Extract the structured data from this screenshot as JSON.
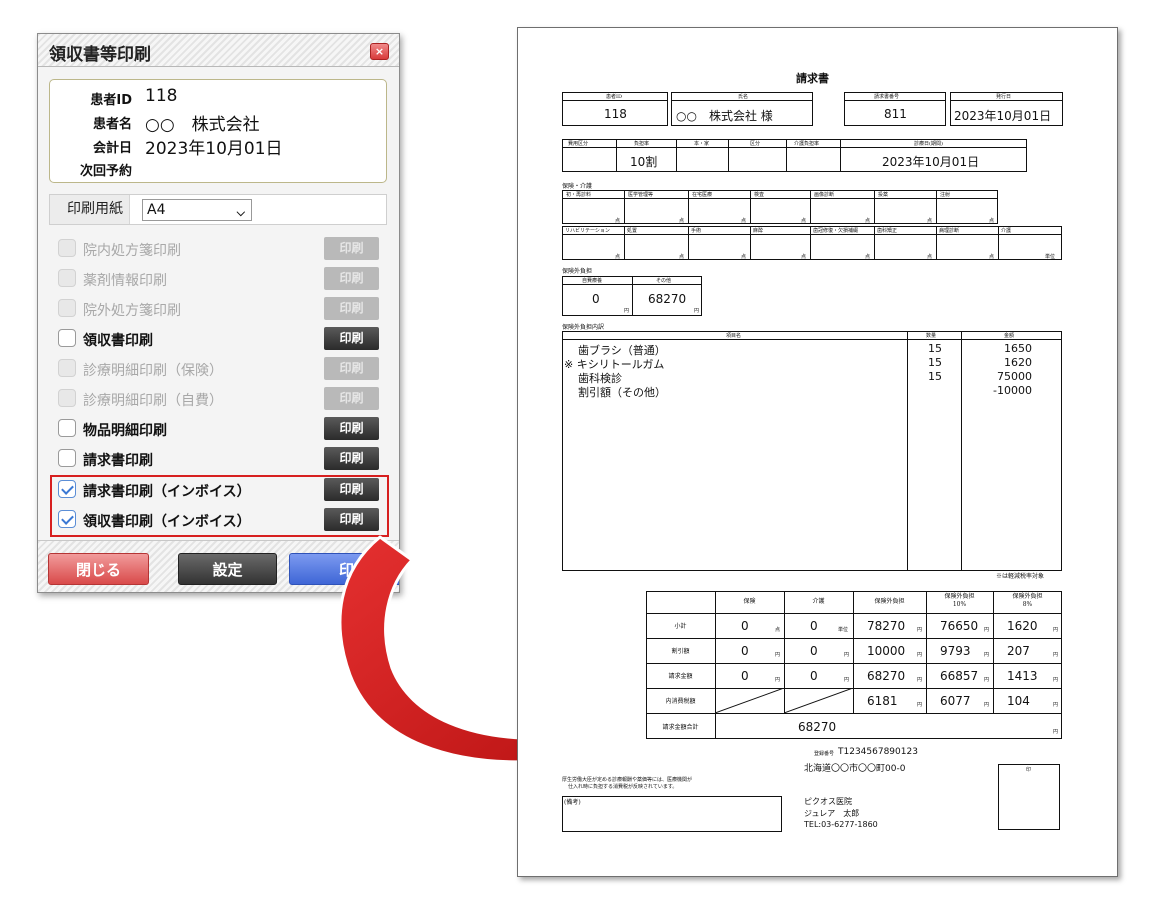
{
  "dialog": {
    "title": "領収書等印刷",
    "close_icon": "×",
    "patient": {
      "id_label": "患者ID",
      "id_value": "118",
      "name_label": "患者名",
      "name_value": "○○　株式会社",
      "date_label": "会計日",
      "date_value": "2023年10月01日",
      "next_label": "次回予約",
      "next_value": ""
    },
    "paper": {
      "label": "印刷用紙",
      "value": "A4"
    },
    "options": [
      {
        "label": "院内処方箋印刷",
        "enabled": false,
        "checked": false,
        "button": "印刷"
      },
      {
        "label": "薬剤情報印刷",
        "enabled": false,
        "checked": false,
        "button": "印刷"
      },
      {
        "label": "院外処方箋印刷",
        "enabled": false,
        "checked": false,
        "button": "印刷"
      },
      {
        "label": "領収書印刷",
        "enabled": true,
        "checked": false,
        "button": "印刷"
      },
      {
        "label": "診療明細印刷（保険）",
        "enabled": false,
        "checked": false,
        "button": "印刷"
      },
      {
        "label": "診療明細印刷（自費）",
        "enabled": false,
        "checked": false,
        "button": "印刷"
      },
      {
        "label": "物品明細印刷",
        "enabled": true,
        "checked": false,
        "button": "印刷"
      },
      {
        "label": "請求書印刷",
        "enabled": true,
        "checked": false,
        "button": "印刷"
      },
      {
        "label": "請求書印刷（インボイス）",
        "enabled": true,
        "checked": true,
        "button": "印刷"
      },
      {
        "label": "領収書印刷（インボイス）",
        "enabled": true,
        "checked": true,
        "button": "印刷"
      }
    ],
    "footer": {
      "close": "閉じる",
      "settings": "設定",
      "print": "印刷"
    }
  },
  "invoice": {
    "title": "請求書",
    "header": {
      "patient_id_label": "患者ID",
      "patient_id": "118",
      "name_label": "氏名",
      "name": "○○　株式会社 様",
      "invoice_no_label": "請求書番号",
      "invoice_no": "811",
      "issue_date_label": "発行日",
      "issue_date": "2023年10月01日"
    },
    "row2": {
      "labels": [
        "費用区分",
        "負担率",
        "本・家",
        "区分",
        "介護負担率",
        "診療日(期間)"
      ],
      "rate": "10割",
      "period": "2023年10月01日"
    },
    "insurance_label": "保険・介護",
    "ins_row1": [
      "初・再診料",
      "医学管理等",
      "在宅医療",
      "検査",
      "画像診断",
      "投薬",
      "注射"
    ],
    "ins_row2": [
      "リハビリテーション",
      "処置",
      "手術",
      "麻酔",
      "歯冠修復・欠損補綴",
      "歯科矯正",
      "病理診断",
      "介護"
    ],
    "unit_point": "点",
    "unit_tan": "単位",
    "unit_yen": "円",
    "self_pay_label": "保険外負担",
    "self_pay_cols": [
      "自費療養",
      "その他"
    ],
    "self_pay_values": [
      "0",
      "68270"
    ],
    "detail_label": "保険外負担内訳",
    "detail_cols": [
      "項目名",
      "数量",
      "金額"
    ],
    "items": [
      {
        "name": "歯ブラシ（普通）",
        "qty": "15",
        "amount": "1650"
      },
      {
        "name": "※ キシリトールガム",
        "qty": "15",
        "amount": "1620"
      },
      {
        "name": "歯科検診",
        "qty": "15",
        "amount": "75000"
      },
      {
        "name": "割引額（その他）",
        "qty": "",
        "amount": "-10000"
      }
    ],
    "reduced_note": "※は軽減税率対象",
    "summary_cols": [
      "保険",
      "介護",
      "保険外負担",
      "保険外負担\n10%",
      "保険外負担\n8%"
    ],
    "summary_rows": [
      {
        "label": "小計",
        "ins": "0",
        "care": "0",
        "ext": "78270",
        "ext10": "76650",
        "ext8": "1620"
      },
      {
        "label": "割引額",
        "ins": "0",
        "care": "0",
        "ext": "10000",
        "ext10": "9793",
        "ext8": "207"
      },
      {
        "label": "請求金額",
        "ins": "0",
        "care": "0",
        "ext": "68270",
        "ext10": "66857",
        "ext8": "1413"
      },
      {
        "label": "内消費税額",
        "ins": "",
        "care": "",
        "ext": "6181",
        "ext10": "6077",
        "ext8": "104"
      }
    ],
    "total_label": "請求金額合計",
    "total": "68270",
    "reg_label": "登録番号",
    "reg_no": "T1234567890123",
    "address": "北海道〇〇市〇〇町00-0",
    "notice1": "厚生労働大臣が定める診療報酬や薬価等には、医療機関が",
    "notice2": "仕入れ時に負担する消費税が反映されています。",
    "remarks_label": "(備考)",
    "clinic": "ピクオス医院",
    "doctor": "ジュレア　太郎",
    "tel": "TEL:03-6277-1860",
    "stamp_label": "印"
  },
  "colors": {
    "highlight": "#d71f1f",
    "arrow": "#d41c1c",
    "close_button": "#d94a4a",
    "print_button": "#3f66d6"
  }
}
